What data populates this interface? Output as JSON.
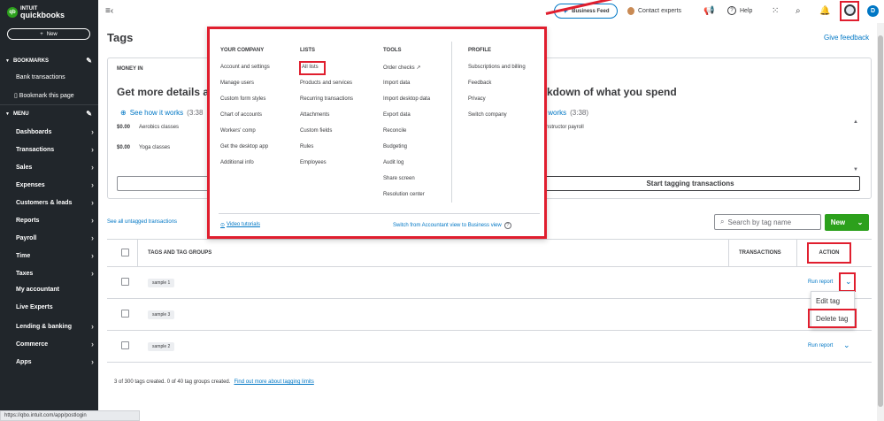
{
  "brand": {
    "line1": "INTUIT",
    "line2": "quickbooks",
    "logo_mark": "qb"
  },
  "sidebar": {
    "new_label": "New",
    "bookmarks_label": "BOOKMARKS",
    "bookmarks": [
      "Bank transactions",
      "Bookmark this page"
    ],
    "menu_label": "MENU",
    "menu_items": [
      "Dashboards",
      "Transactions",
      "Sales",
      "Expenses",
      "Customers & leads",
      "Reports",
      "Payroll",
      "Time",
      "Taxes",
      "My accountant",
      "Live Experts",
      "Lending & banking",
      "Commerce",
      "Apps"
    ]
  },
  "topbar": {
    "business_feed": "Business Feed",
    "contact_experts": "Contact experts",
    "help": "Help",
    "user_initial": "D"
  },
  "page": {
    "title": "Tags",
    "feedback": "Give feedback"
  },
  "money_card": {
    "label": "MONEY IN",
    "headline_left": "Get more details a",
    "headline_right": "kdown of what you spend",
    "see_how_left": "See how it works",
    "dur_left": "(3:38",
    "see_how_right": "it works",
    "dur_right": "(3:38)",
    "rows": [
      {
        "amount": "$0.00",
        "name": "Aerobics classes"
      },
      {
        "amount": "$0.00",
        "name": "Yoga classes"
      }
    ],
    "right_row": "nstructor payroll",
    "start_tagging": "Start tagging transactions"
  },
  "see_untagged": "See all untagged transactions",
  "search": {
    "placeholder": "Search by tag name"
  },
  "new_button": "New",
  "table": {
    "headers": {
      "tags": "TAGS AND TAG GROUPS",
      "transactions": "TRANSACTIONS",
      "action": "ACTION"
    },
    "rows": [
      {
        "tag": "sample 1",
        "action": "Run report"
      },
      {
        "tag": "sample 3",
        "action": ""
      },
      {
        "tag": "sample 2",
        "action": "Run report"
      }
    ]
  },
  "row_menu": {
    "edit": "Edit tag",
    "delete": "Delete tag"
  },
  "footer": {
    "counts": "3 of 300 tags created. 0 of 40 tag groups created.",
    "link": "Find out more about tagging limits"
  },
  "status_url": "https://qbo.intuit.com/app/postlogin",
  "mega_menu": {
    "your_company": {
      "heading": "YOUR COMPANY",
      "items": [
        "Account and settings",
        "Manage users",
        "Custom form styles",
        "Chart of accounts",
        "Workers' comp",
        "Get the desktop app",
        "Additional info"
      ]
    },
    "lists": {
      "heading": "LISTS",
      "items": [
        "All lists",
        "Products and services",
        "Recurring transactions",
        "Attachments",
        "Custom fields",
        "Rules",
        "Employees"
      ]
    },
    "tools": {
      "heading": "TOOLS",
      "items": [
        "Order checks",
        "Import data",
        "Import desktop data",
        "Export data",
        "Reconcile",
        "Budgeting",
        "Audit log",
        "Share screen",
        "Resolution center"
      ]
    },
    "profile": {
      "heading": "PROFILE",
      "items": [
        "Subscriptions and billing",
        "Feedback",
        "Privacy",
        "Switch company"
      ]
    },
    "video_tutorials": "Video tutorials",
    "switch_view": "Switch from Accountant view to Business view"
  },
  "colors": {
    "accent_green": "#2ca01c",
    "link_blue": "#0077c5",
    "highlight_red": "#e01e2e",
    "sidebar_bg": "#21262b"
  }
}
